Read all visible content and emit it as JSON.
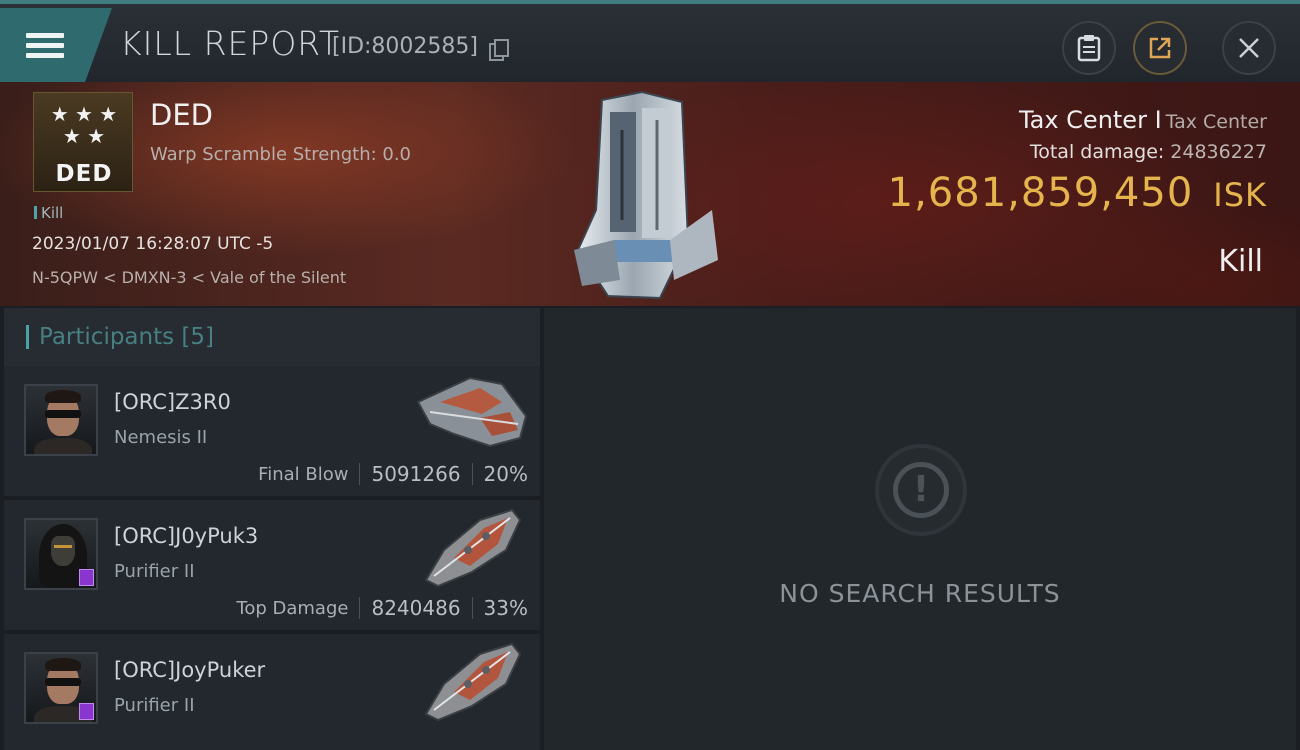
{
  "header": {
    "title": "KILL REPORT",
    "report_id": "[ID:8002585]"
  },
  "icons": {
    "menu": "menu-icon",
    "copy": "copy-icon",
    "notes": "clipboard-icon",
    "share": "share-icon",
    "close": "close-icon"
  },
  "victim": {
    "badge_stars": "★ ★ ★\n★ ★",
    "badge_label": "DED",
    "name": "DED",
    "subtitle": "Warp Scramble Strength: 0.0",
    "flag": "Kill",
    "datetime": "2023/01/07 16:28:07 UTC -5",
    "location": "N-5QPW < DMXN-3 < Vale of the Silent"
  },
  "target": {
    "name": "Tax Center I",
    "type": "Tax Center",
    "total_damage_label": "Total damage:",
    "total_damage": "24836227",
    "isk_value": "1,681,859,450",
    "isk_unit": "ISK",
    "result": "Kill"
  },
  "participants": {
    "label": "Participants",
    "count": "[5]",
    "items": [
      {
        "name": "[ORC]Z3R0",
        "ship": "Nemesis II",
        "tag": "Final Blow",
        "damage": "5091266",
        "percent": "20%"
      },
      {
        "name": "[ORC]J0yPuk3",
        "ship": "Purifier II",
        "tag": "Top Damage",
        "damage": "8240486",
        "percent": "33%"
      },
      {
        "name": "[ORC]JoyPuker",
        "ship": "Purifier II",
        "tag": "",
        "damage": "",
        "percent": ""
      }
    ]
  },
  "details": {
    "empty_text": "NO SEARCH RESULTS"
  },
  "colors": {
    "accent_teal": "#3f7d80",
    "isk_gold": "#e6b44c",
    "banner_red": "#5a2a22"
  }
}
